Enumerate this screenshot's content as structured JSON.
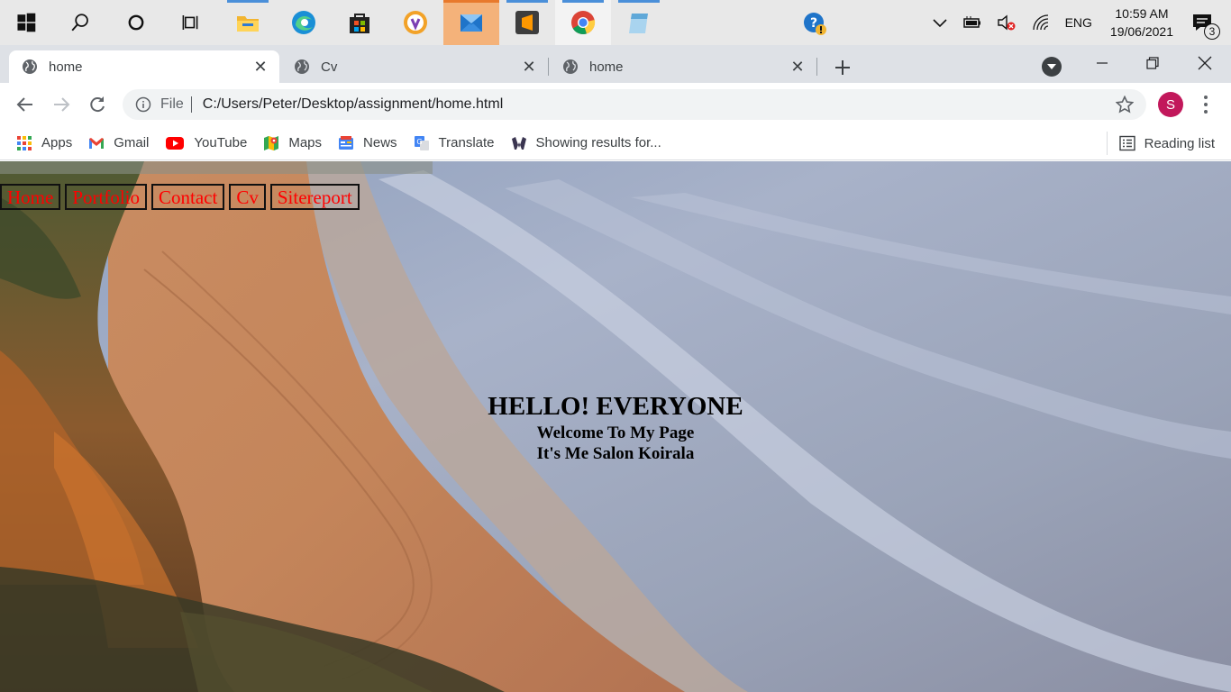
{
  "taskbar": {
    "tray": {
      "language": "ENG",
      "time": "10:59 AM",
      "date": "19/06/2021",
      "notification_count": "3"
    }
  },
  "browser": {
    "tabs": [
      {
        "title": "home",
        "active": true
      },
      {
        "title": "Cv",
        "active": false
      },
      {
        "title": "home",
        "active": false
      }
    ],
    "address": {
      "scheme_label": "File",
      "url": "C:/Users/Peter/Desktop/assignment/home.html"
    },
    "profile_initial": "S",
    "profile_color": "#c2185b",
    "bookmarks": [
      {
        "label": "Apps",
        "icon": "apps-grid-icon"
      },
      {
        "label": "Gmail",
        "icon": "gmail-icon"
      },
      {
        "label": "YouTube",
        "icon": "youtube-icon"
      },
      {
        "label": "Maps",
        "icon": "maps-icon"
      },
      {
        "label": "News",
        "icon": "news-icon"
      },
      {
        "label": "Translate",
        "icon": "translate-icon"
      },
      {
        "label": "Showing results for...",
        "icon": "site-icon"
      }
    ],
    "reading_list": "Reading list"
  },
  "page": {
    "nav": [
      {
        "label": "Home"
      },
      {
        "label": "Portfolio"
      },
      {
        "label": "Contact"
      },
      {
        "label": "Cv"
      },
      {
        "label": "Sitereport"
      }
    ],
    "nav_color": "#ff0000",
    "heading": "HELLO! EVERYONE",
    "line1": "Welcome To My Page",
    "line2": "It's Me Salon Koirala"
  }
}
